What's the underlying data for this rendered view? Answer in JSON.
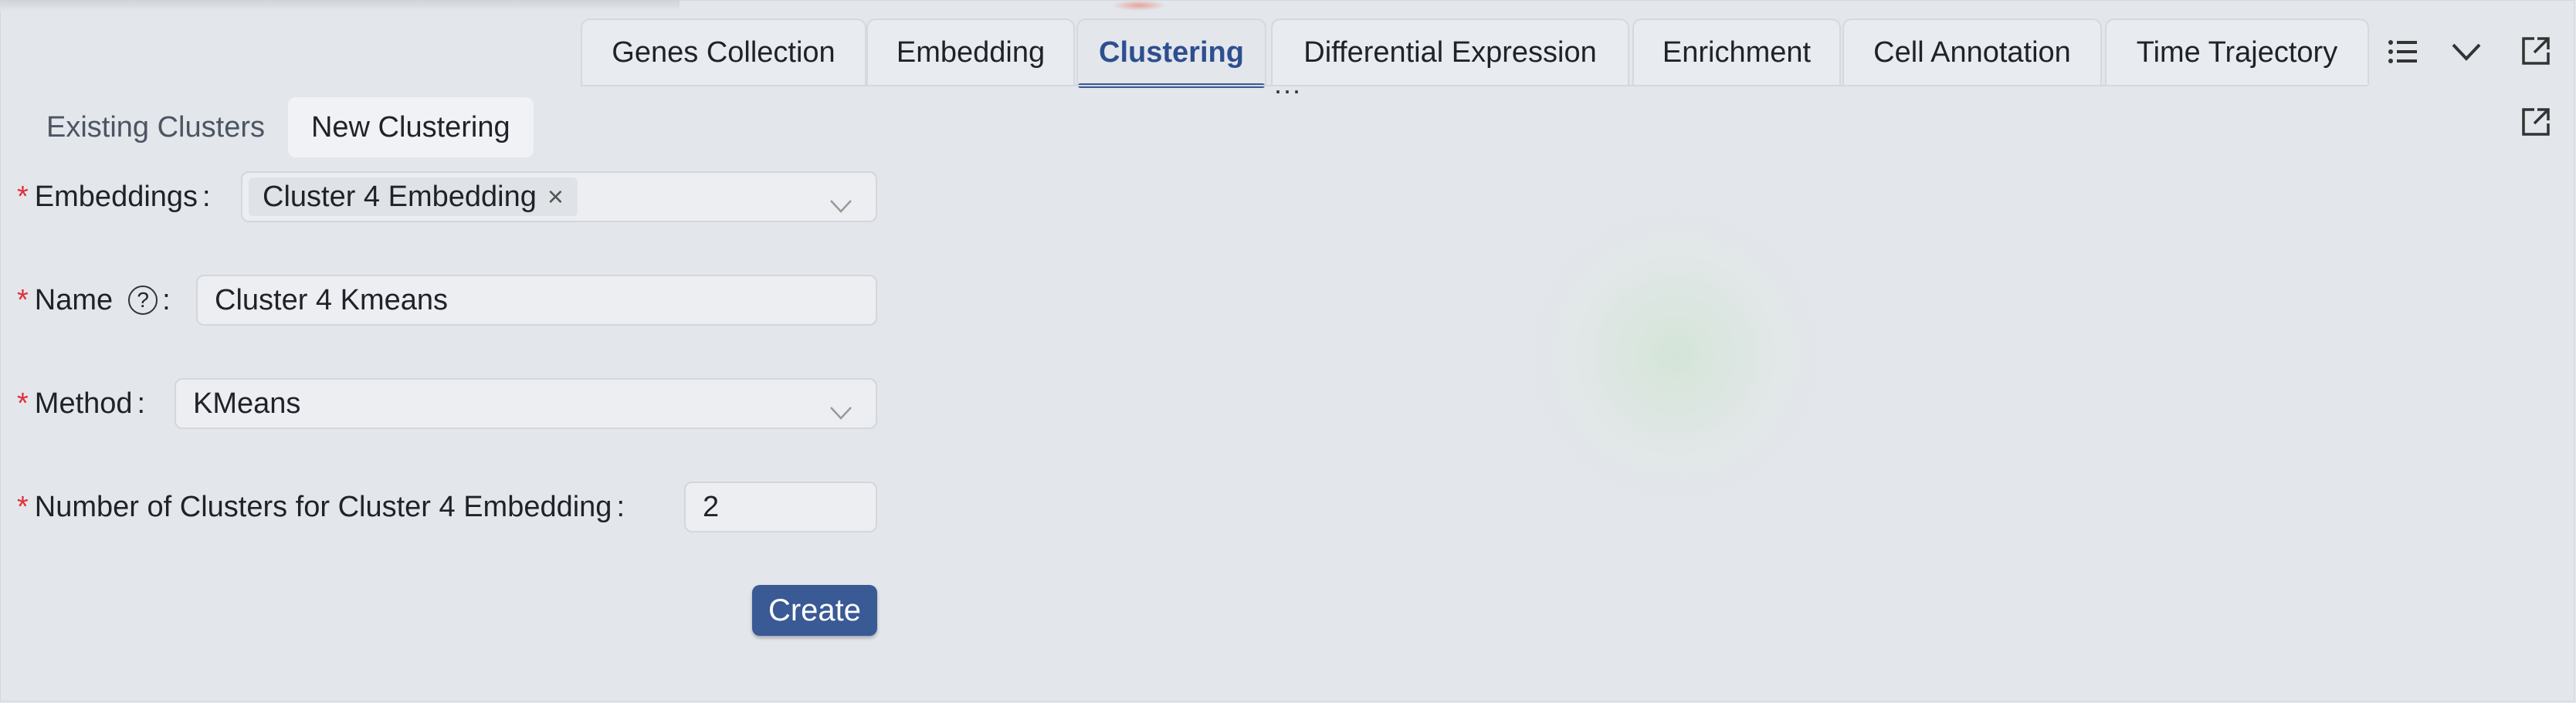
{
  "tabs": [
    {
      "label": "Genes Collection"
    },
    {
      "label": "Embedding"
    },
    {
      "label": "Clustering"
    },
    {
      "label": "Differential Expression"
    },
    {
      "label": "Enrichment"
    },
    {
      "label": "Cell Annotation"
    },
    {
      "label": "Time Trajectory"
    }
  ],
  "active_tab": "Clustering",
  "more_indicator": "...",
  "toolbar_icons": [
    "list-icon",
    "chevron-down-icon",
    "external-link-icon"
  ],
  "subtabs": [
    {
      "label": "Existing Clusters"
    },
    {
      "label": "New Clustering"
    }
  ],
  "form": {
    "embeddings": {
      "label": "Embeddings",
      "tag": "Cluster 4 Embedding"
    },
    "name": {
      "label": "Name",
      "help": "?",
      "value": "Cluster 4 Kmeans"
    },
    "method": {
      "label": "Method",
      "value": "KMeans"
    },
    "num_clusters": {
      "label": "Number of Clusters for Cluster 4 Embedding",
      "value": "2"
    },
    "required_mark": "*",
    "colon": ":",
    "create_label": "Create"
  },
  "colors": {
    "accent": "#3a5a96",
    "required": "#e0303a",
    "background": "#e3e6eb"
  }
}
